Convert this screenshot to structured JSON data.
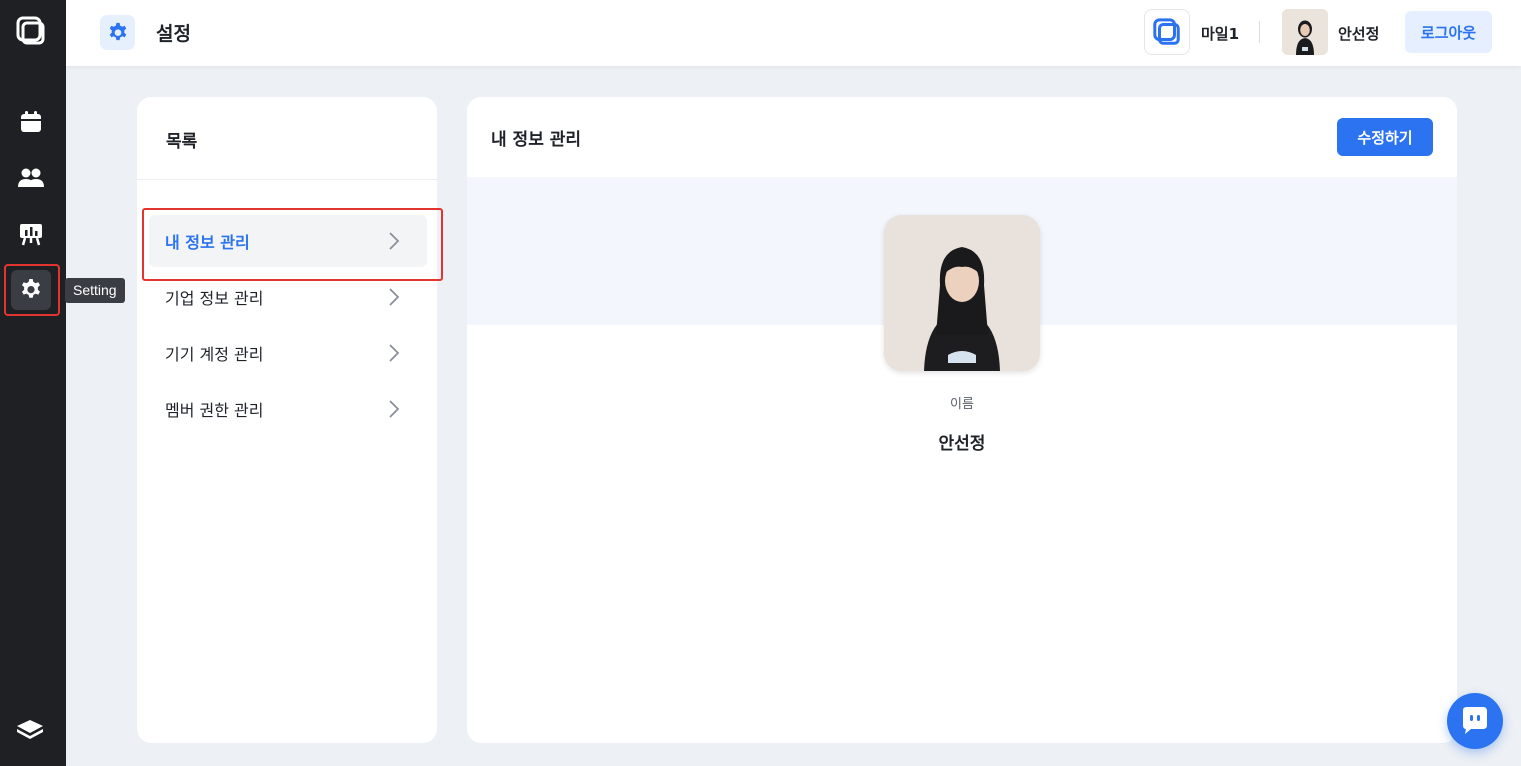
{
  "sidebar": {
    "tooltip": "Setting",
    "items": [
      {
        "icon": "calendar-icon"
      },
      {
        "icon": "users-icon"
      },
      {
        "icon": "presentation-board-icon"
      },
      {
        "icon": "gear-icon",
        "active": true
      }
    ],
    "bottom_icon": "book-icon"
  },
  "header": {
    "title": "설정",
    "org_name": "마일1",
    "user_name": "안선정",
    "logout_label": "로그아웃"
  },
  "menu": {
    "title": "목록",
    "items": [
      {
        "label": "내 정보 관리",
        "active": true
      },
      {
        "label": "기업 정보 관리"
      },
      {
        "label": "기기 계정 관리"
      },
      {
        "label": "멤버 권한 관리"
      }
    ]
  },
  "profile": {
    "title": "내 정보 관리",
    "edit_label": "수정하기",
    "name_label": "이름",
    "name_value": "안선정"
  },
  "colors": {
    "accent": "#2b73f0",
    "rail": "#1f2023",
    "highlight": "#e3342f"
  }
}
